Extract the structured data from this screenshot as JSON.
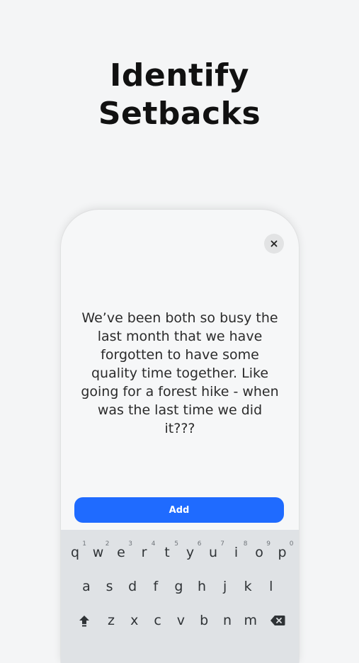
{
  "headline": {
    "line1": "Identify",
    "line2": "Setbacks"
  },
  "card": {
    "close_icon": "close-icon",
    "message": "We’ve been both so busy the last month that we have forgotten to have some quality time together. Like going for a forest hike - when was the last time we did it???",
    "add_label": "Add"
  },
  "keyboard": {
    "row1": [
      {
        "key": "q",
        "hint": "1"
      },
      {
        "key": "w",
        "hint": "2"
      },
      {
        "key": "e",
        "hint": "3"
      },
      {
        "key": "r",
        "hint": "4"
      },
      {
        "key": "t",
        "hint": "5"
      },
      {
        "key": "y",
        "hint": "6"
      },
      {
        "key": "u",
        "hint": "7"
      },
      {
        "key": "i",
        "hint": "8"
      },
      {
        "key": "o",
        "hint": "9"
      },
      {
        "key": "p",
        "hint": "0"
      }
    ],
    "row2": [
      "a",
      "s",
      "d",
      "f",
      "g",
      "h",
      "j",
      "k",
      "l"
    ],
    "row3": [
      "z",
      "x",
      "c",
      "v",
      "b",
      "n",
      "m"
    ],
    "shift_icon": "shift-icon",
    "backspace_icon": "backspace-icon"
  },
  "colors": {
    "background": "#f4f5f6",
    "accent": "#1f6bff",
    "keyboard": "#dfe2e5"
  }
}
